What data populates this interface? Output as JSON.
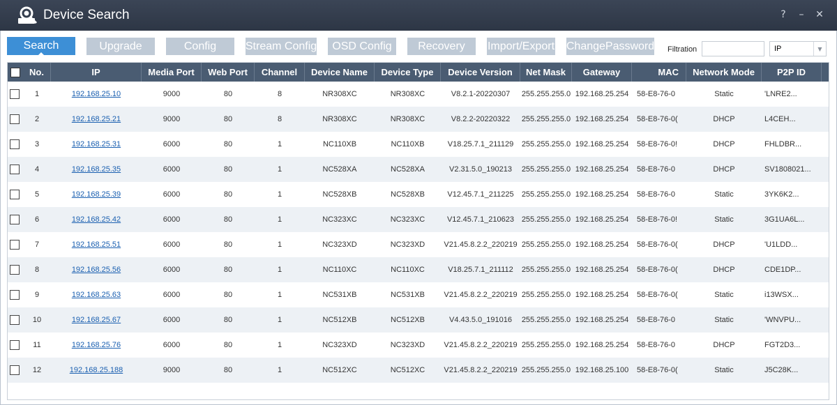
{
  "window": {
    "title": "Device Search",
    "help": "?",
    "minimize": "–",
    "close": "✕"
  },
  "toolbar": {
    "buttons": [
      "Search",
      "Upgrade",
      "Config",
      "Stream Config",
      "OSD Config",
      "Recovery",
      "Import/Export",
      "ChangePassword"
    ],
    "active": "Search"
  },
  "filter": {
    "label": "Filtration",
    "value": "",
    "select_value": "IP"
  },
  "table": {
    "columns": [
      "No.",
      "IP",
      "Media Port",
      "Web Port",
      "Channel",
      "Device Name",
      "Device Type",
      "Device Version",
      "Net Mask",
      "Gateway",
      "MAC",
      "Network Mode",
      "P2P ID"
    ],
    "rows": [
      [
        "1",
        "192.168.25.10",
        "9000",
        "80",
        "8",
        "NR308XC",
        "NR308XC",
        "V8.2.1-20220307",
        "255.255.255.0",
        "192.168.25.254",
        "58-E8-76-0",
        "Static",
        "'LNRE2..."
      ],
      [
        "2",
        "192.168.25.21",
        "9000",
        "80",
        "8",
        "NR308XC",
        "NR308XC",
        "V8.2.2-20220322",
        "255.255.255.0",
        "192.168.25.254",
        "58-E8-76-0(",
        "DHCP",
        "L4CEH..."
      ],
      [
        "3",
        "192.168.25.31",
        "6000",
        "80",
        "1",
        "NC110XB",
        "NC110XB",
        "V18.25.7.1_211129",
        "255.255.255.0",
        "192.168.25.254",
        "58-E8-76-0!",
        "DHCP",
        "FHLDBR..."
      ],
      [
        "4",
        "192.168.25.35",
        "6000",
        "80",
        "1",
        "NC528XA",
        "NC528XA",
        "V2.31.5.0_190213",
        "255.255.255.0",
        "192.168.25.254",
        "58-E8-76-0",
        "DHCP",
        "SV1808021..."
      ],
      [
        "5",
        "192.168.25.39",
        "6000",
        "80",
        "1",
        "NC528XB",
        "NC528XB",
        "V12.45.7.1_211225",
        "255.255.255.0",
        "192.168.25.254",
        "58-E8-76-0",
        "Static",
        "3YK6K2..."
      ],
      [
        "6",
        "192.168.25.42",
        "6000",
        "80",
        "1",
        "NC323XC",
        "NC323XC",
        "V12.45.7.1_210623",
        "255.255.255.0",
        "192.168.25.254",
        "58-E8-76-0!",
        "Static",
        "3G1UA6L..."
      ],
      [
        "7",
        "192.168.25.51",
        "6000",
        "80",
        "1",
        "NC323XD",
        "NC323XD",
        "V21.45.8.2.2_220219",
        "255.255.255.0",
        "192.168.25.254",
        "58-E8-76-0(",
        "DHCP",
        "'U1LDD..."
      ],
      [
        "8",
        "192.168.25.56",
        "6000",
        "80",
        "1",
        "NC110XC",
        "NC110XC",
        "V18.25.7.1_211112",
        "255.255.255.0",
        "192.168.25.254",
        "58-E8-76-0(",
        "DHCP",
        "CDE1DP..."
      ],
      [
        "9",
        "192.168.25.63",
        "6000",
        "80",
        "1",
        "NC531XB",
        "NC531XB",
        "V21.45.8.2.2_220219",
        "255.255.255.0",
        "192.168.25.254",
        "58-E8-76-0(",
        "Static",
        "i13WSX..."
      ],
      [
        "10",
        "192.168.25.67",
        "6000",
        "80",
        "1",
        "NC512XB",
        "NC512XB",
        "V4.43.5.0_191016",
        "255.255.255.0",
        "192.168.25.254",
        "58-E8-76-0",
        "Static",
        "'WNVPU..."
      ],
      [
        "11",
        "192.168.25.76",
        "6000",
        "80",
        "1",
        "NC323XD",
        "NC323XD",
        "V21.45.8.2.2_220219",
        "255.255.255.0",
        "192.168.25.254",
        "58-E8-76-0",
        "DHCP",
        "FGT2D3..."
      ],
      [
        "12",
        "192.168.25.188",
        "9000",
        "80",
        "1",
        "NC512XC",
        "NC512XC",
        "V21.45.8.2.2_220219",
        "255.255.255.0",
        "192.168.25.100",
        "58-E8-76-0(",
        "Static",
        "J5C28K..."
      ]
    ]
  },
  "icons": {
    "logo": "device-search-logo-icon",
    "select_arrow": "chevron-down-icon"
  },
  "colors": {
    "titlebar": "#323c4c",
    "active_button": "#3d8fd6",
    "inactive_button": "#bfcad6",
    "header": "#4a5c72",
    "link": "#1a5fb0"
  }
}
